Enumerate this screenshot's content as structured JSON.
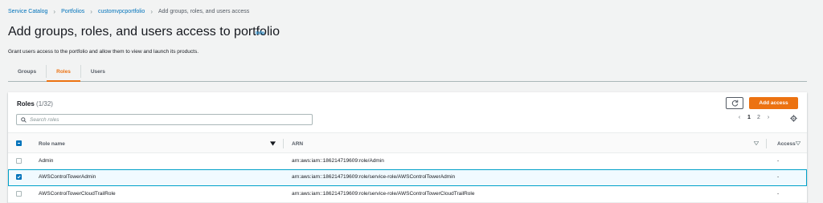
{
  "breadcrumb": [
    {
      "label": "Service Catalog",
      "link": true
    },
    {
      "label": "Portfolios",
      "link": true
    },
    {
      "label": "customvpcportfolio",
      "link": true
    },
    {
      "label": "Add groups, roles, and users access",
      "link": false
    }
  ],
  "header": {
    "title": "Add groups, roles, and users access to portfolio",
    "info": "Info",
    "description": "Grant users access to the portfolio and allow them to view and launch its products."
  },
  "tabs": [
    {
      "label": "Groups",
      "active": false
    },
    {
      "label": "Roles",
      "active": true
    },
    {
      "label": "Users",
      "active": false
    }
  ],
  "panel": {
    "title": "Roles",
    "count": "(1/32)",
    "add_button": "Add access",
    "refresh_icon": "refresh-icon"
  },
  "search": {
    "placeholder": "Search roles",
    "value": ""
  },
  "pagination": {
    "pages": [
      "1",
      "2"
    ],
    "current": "1"
  },
  "table": {
    "columns": {
      "name": "Role name",
      "arn": "ARN",
      "access": "Access"
    },
    "rows": [
      {
        "name": "Admin",
        "arn": "arn:aws:iam::186214719609:role/Admin",
        "access": "-",
        "selected": false
      },
      {
        "name": "AWSControlTowerAdmin",
        "arn": "arn:aws:iam::186214719609:role/service-role/AWSControlTowerAdmin",
        "access": "-",
        "selected": true
      },
      {
        "name": "AWSControlTowerCloudTrailRole",
        "arn": "arn:aws:iam::186214719609:role/service-role/AWSControlTowerCloudTrailRole",
        "access": "-",
        "selected": false
      }
    ]
  },
  "colors": {
    "accent": "#ec7211",
    "link": "#0073bb",
    "selection": "#00a1c9",
    "background": "#f2f3f3"
  }
}
